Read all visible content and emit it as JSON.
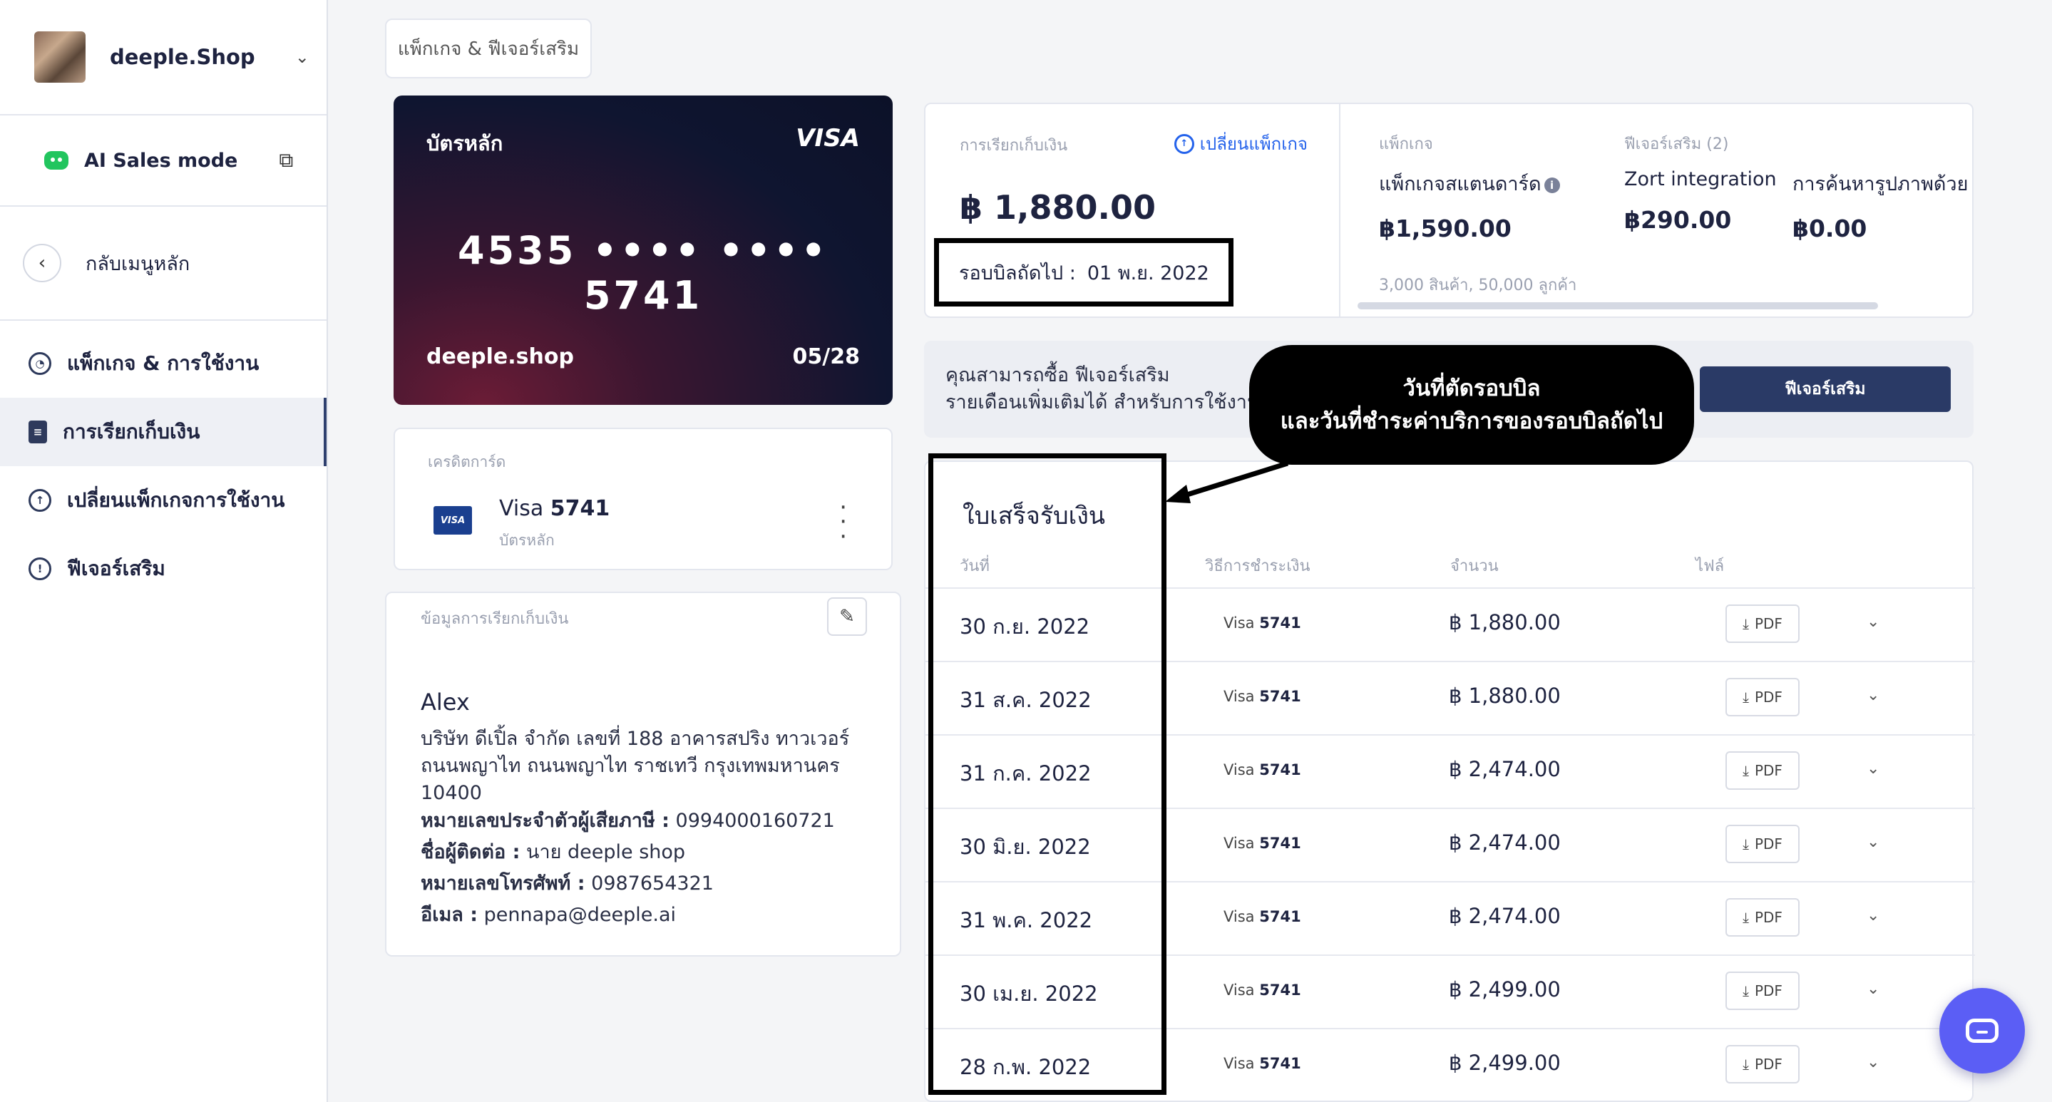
{
  "sidebar": {
    "shop_name": "deeple.Shop",
    "ai_mode_label": "AI Sales mode",
    "back_label": "กลับเมนูหลัก",
    "items": [
      {
        "label": "แพ็กเกจ & การใช้งาน",
        "icon": "gauge-icon",
        "active": false
      },
      {
        "label": "การเรียกเก็บเงิน",
        "icon": "invoice-icon",
        "active": true
      },
      {
        "label": "เปลี่ยนแพ็กเกจการใช้งาน",
        "icon": "upgrade-icon",
        "active": false
      },
      {
        "label": "ฟีเจอร์เสริม",
        "icon": "addon-icon",
        "active": false
      }
    ]
  },
  "tab_label": "แพ็กเกจ & ฟีเจอร์เสริม",
  "card": {
    "title": "บัตรหลัก",
    "brand": "VISA",
    "number": "4535 •••• •••• 5741",
    "holder": "deeple.shop",
    "expiry": "05/28"
  },
  "credit_card": {
    "section_label": "เครดิตการ์ด",
    "logo_text": "VISA",
    "brand": "Visa",
    "last4": "5741",
    "subtitle": "บัตรหลัก"
  },
  "billing_info": {
    "section_label": "ข้อมูลการเรียกเก็บเงิน",
    "name": "Alex",
    "address": "บริษัท ดีเปิ้ล จำกัด เลขที่ 188 อาคารสปริง ทาวเวอร์ ถนนพญาไท ถนนพญาไท ราชเทวี กรุงเทพมหานคร 10400",
    "tax_id_label": "หมายเลขประจำตัวผู้เสียภาษี :",
    "tax_id": "0994000160721",
    "contact_label": "ชื่อผู้ติดต่อ :",
    "contact": "นาย deeple shop",
    "phone_label": "หมายเลขโทรศัพท์ :",
    "phone": "0987654321",
    "email_label": "อีเมล :",
    "email": "pennapa@deeple.ai"
  },
  "billing_summary": {
    "label": "การเรียกเก็บเงิน",
    "change_package": "เปลี่ยนแพ็กเกจ",
    "amount": "฿ 1,880.00",
    "next_cycle_label": "รอบบิลถัดไป :",
    "next_cycle_date": "01 พ.ย. 2022"
  },
  "package": {
    "package_label": "แพ็กเกจ",
    "addons_label": "ฟีเจอร์เสริม (2)",
    "plan_name": "แพ็กเกจสแตนดาร์ด",
    "plan_price": "฿1,590.00",
    "plan_note": "3,000 สินค้า, 50,000 ลูกค้า",
    "addon1_name": "Zort integration",
    "addon1_price": "฿290.00",
    "addon2_name": "การค้นหารูปภาพด้วย AI",
    "addon2_price": "฿0.00"
  },
  "promo": {
    "line1": "คุณสามารถซื้อ ฟีเจอร์เสริม",
    "line2": "รายเดือนเพิ่มเติมได้ สำหรับการใช้งาน",
    "button": "ฟีเจอร์เสริม"
  },
  "callout": {
    "line1": "วันที่ตัดรอบบิล",
    "line2": "และวันที่ชำระค่าบริการของรอบบิลถัดไป"
  },
  "receipts": {
    "title": "ใบเสร็จรับเงิน",
    "headers": {
      "date": "วันที่",
      "method": "วิธีการชำระเงิน",
      "amount": "จำนวน",
      "file": "ไฟล์"
    },
    "rows": [
      {
        "date": "30 ก.ย. 2022",
        "method": "Visa",
        "last4": "5741",
        "amount": "฿ 1,880.00",
        "file": "PDF"
      },
      {
        "date": "31 ส.ค. 2022",
        "method": "Visa",
        "last4": "5741",
        "amount": "฿ 1,880.00",
        "file": "PDF"
      },
      {
        "date": "31 ก.ค. 2022",
        "method": "Visa",
        "last4": "5741",
        "amount": "฿ 2,474.00",
        "file": "PDF"
      },
      {
        "date": "30 มิ.ย. 2022",
        "method": "Visa",
        "last4": "5741",
        "amount": "฿ 2,474.00",
        "file": "PDF"
      },
      {
        "date": "31 พ.ค. 2022",
        "method": "Visa",
        "last4": "5741",
        "amount": "฿ 2,474.00",
        "file": "PDF"
      },
      {
        "date": "30 เม.ย. 2022",
        "method": "Visa",
        "last4": "5741",
        "amount": "฿ 2,499.00",
        "file": "PDF"
      },
      {
        "date": "28 ก.พ. 2022",
        "method": "Visa",
        "last4": "5741",
        "amount": "฿ 2,499.00",
        "file": "PDF"
      }
    ]
  },
  "colors": {
    "brand_navy": "#2a3a66",
    "link_blue": "#2563eb",
    "chat_purple": "#5b5ef5",
    "ai_green": "#22c55e"
  }
}
